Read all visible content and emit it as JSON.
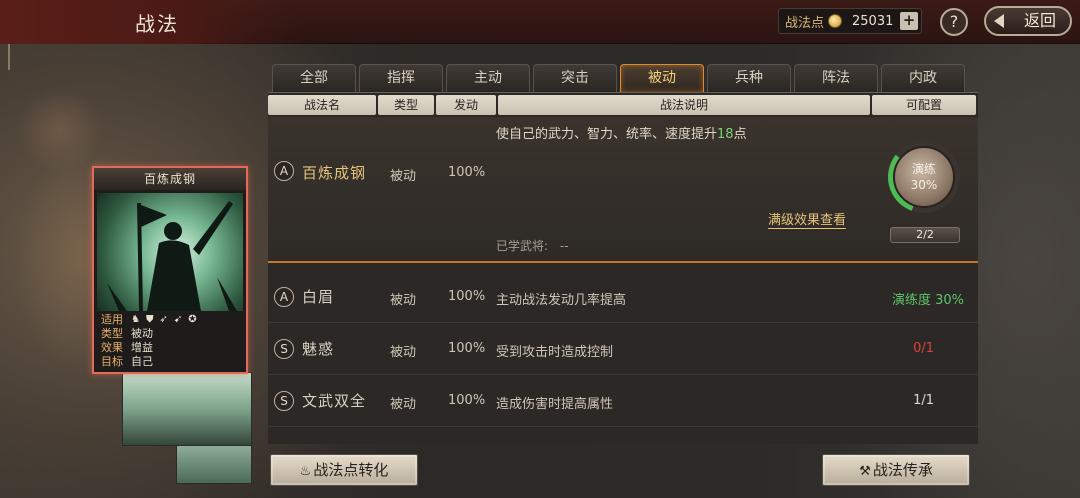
{
  "header": {
    "title": "战法",
    "points_label": "战法点",
    "points_value": "25031",
    "plus_label": "+",
    "help_label": "?",
    "back_label": "返回"
  },
  "tabs": [
    {
      "label": "全部",
      "active": false
    },
    {
      "label": "指挥",
      "active": false
    },
    {
      "label": "主动",
      "active": false
    },
    {
      "label": "突击",
      "active": false
    },
    {
      "label": "被动",
      "active": true
    },
    {
      "label": "兵种",
      "active": false
    },
    {
      "label": "阵法",
      "active": false
    },
    {
      "label": "内政",
      "active": false
    }
  ],
  "columns": {
    "name": "战法名",
    "type": "类型",
    "rate": "发动",
    "desc": "战法说明",
    "config": "可配置"
  },
  "expanded": {
    "grade": "A",
    "name": "百炼成钢",
    "type": "被动",
    "rate": "100%",
    "desc_prefix": "使自己的武力、智力、统率、速度提升",
    "desc_num": "18",
    "desc_suffix": "点",
    "full_level_link": "满级效果查看",
    "learned_label": "已学武将:",
    "learned_value": "--",
    "practice_label": "演练",
    "practice_value": "30%",
    "practice_fraction": 0.3,
    "practice_count": "2/2"
  },
  "rows": [
    {
      "grade": "A",
      "name": "白眉",
      "type": "被动",
      "rate": "100%",
      "desc": "主动战法发动几率提高",
      "config": "演练度 30%",
      "config_color": "#5cc46a"
    },
    {
      "grade": "S",
      "name": "魅惑",
      "type": "被动",
      "rate": "100%",
      "desc": "受到攻击时造成控制",
      "config": "0/1",
      "config_color": "#d8433a"
    },
    {
      "grade": "S",
      "name": "文武双全",
      "type": "被动",
      "rate": "100%",
      "desc": "造成伤害时提高属性",
      "config": "1/1",
      "config_color": "#e0d8ca"
    }
  ],
  "card": {
    "title": "百炼成钢",
    "applicable_label": "适用",
    "unit_icons": [
      "cavalry-icon",
      "shield-icon",
      "bow-icon",
      "spear-icon",
      "siege-icon"
    ],
    "type_label": "类型",
    "type_value": "被动",
    "effect_label": "效果",
    "effect_value": "增益",
    "target_label": "目标",
    "target_value": "自己"
  },
  "buttons": {
    "convert": "战法点转化",
    "inherit": "战法传承"
  },
  "colors": {
    "active_tab": "#e08a2e",
    "highlight_num": "#7fd07a",
    "card_border": "#e26a5a"
  }
}
